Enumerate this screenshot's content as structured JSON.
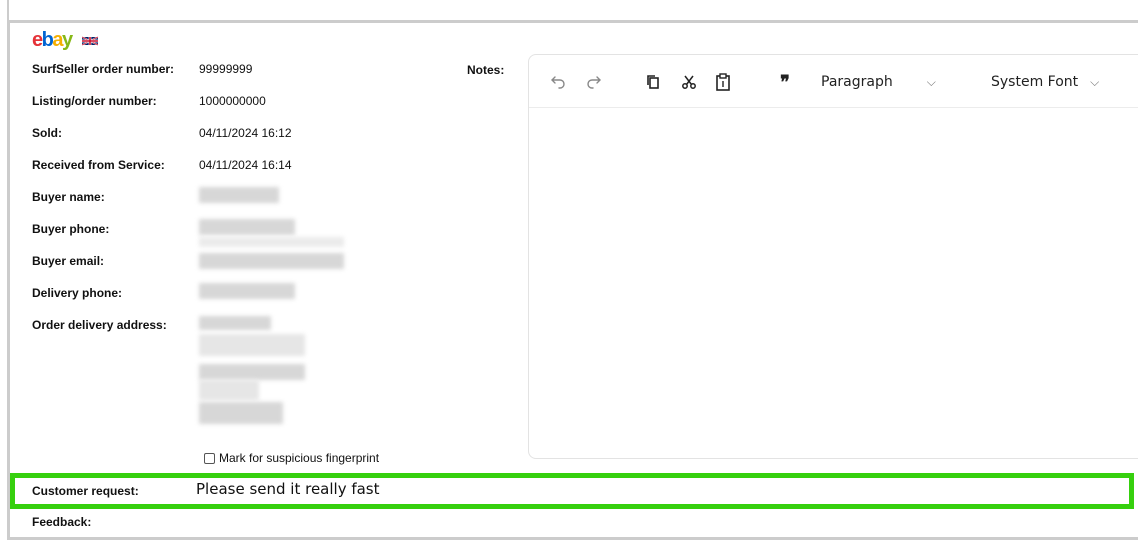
{
  "brand": {
    "logo_letters": [
      {
        "char": "e",
        "color": "#e53238"
      },
      {
        "char": "b",
        "color": "#0064d2"
      },
      {
        "char": "a",
        "color": "#f5af02"
      },
      {
        "char": "y",
        "color": "#86b817"
      }
    ],
    "flag_icon": "uk-flag-icon"
  },
  "order_details": {
    "fields": [
      {
        "label": "SurfSeller order number:",
        "value": "99999999"
      },
      {
        "label": "Listing/order number:",
        "value": "1000000000"
      },
      {
        "label": "Sold:",
        "value": "04/11/2024 16:12"
      },
      {
        "label": "Received from Service:",
        "value": "04/11/2024 16:14"
      },
      {
        "label": "Buyer name:",
        "value": ""
      },
      {
        "label": "Buyer phone:",
        "value": ""
      },
      {
        "label": "Buyer email:",
        "value": ""
      },
      {
        "label": "Delivery phone:",
        "value": ""
      },
      {
        "label": "Order delivery address:",
        "value": ""
      }
    ]
  },
  "notes": {
    "label": "Notes:",
    "toolbar": {
      "undo_icon": "undo-icon",
      "redo_icon": "redo-icon",
      "copy_icon": "copy-icon",
      "cut_icon": "scissors-icon",
      "paste_icon": "clipboard-icon",
      "blockquote_icon": "quote-icon",
      "block_format": "Paragraph",
      "font_family": "System Font",
      "font_size": "1"
    }
  },
  "suspicious_fingerprint": {
    "label": "Mark for suspicious fingerprint",
    "checked": false
  },
  "customer_request": {
    "label": "Customer request:",
    "value": "Please send it really fast",
    "highlight_color": "#36d00e"
  },
  "feedback": {
    "label": "Feedback:"
  }
}
